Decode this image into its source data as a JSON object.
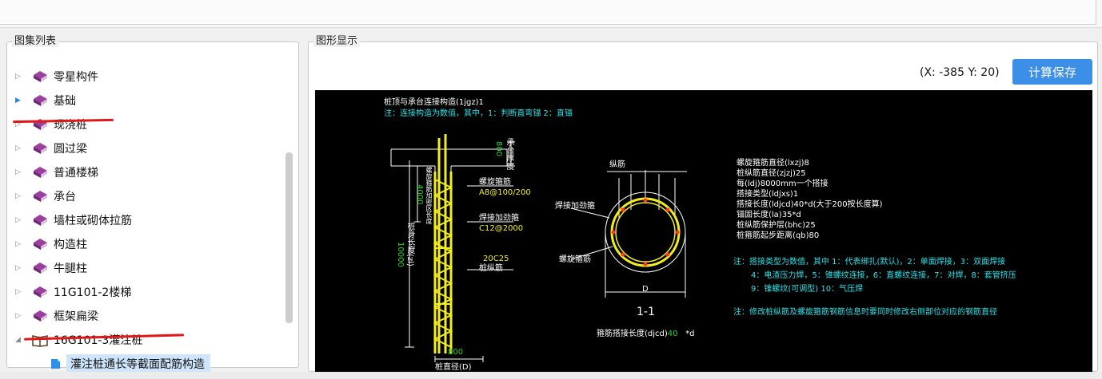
{
  "left_panel": {
    "title": "图集列表",
    "items": [
      {
        "label": "零星构件",
        "arrow": "▷"
      },
      {
        "label": "基础",
        "arrow": "▶"
      },
      {
        "label": "现浇桩",
        "arrow": "▷"
      },
      {
        "label": "圆过梁",
        "arrow": "▷"
      },
      {
        "label": "普通楼梯",
        "arrow": "▷"
      },
      {
        "label": "承台",
        "arrow": "▷"
      },
      {
        "label": "墙柱或砌体拉筋",
        "arrow": "▷"
      },
      {
        "label": "构造柱",
        "arrow": "▷"
      },
      {
        "label": "牛腿柱",
        "arrow": "▷"
      },
      {
        "label": "11G101-2楼梯",
        "arrow": "▷"
      },
      {
        "label": "框架扁梁",
        "arrow": "▷"
      },
      {
        "label": "16G101-3灌注桩",
        "arrow": "◢"
      }
    ],
    "child": {
      "label": "灌注桩通长等截面配筋构造"
    }
  },
  "right_panel": {
    "title": "图形显示",
    "coord": "(X: -385 Y: 20)",
    "calc_button": "计算保存"
  },
  "drawing": {
    "header1": "桩顶与承台连接构造(1jgz)1",
    "header2": "注：连接构造为数值，其中，1：判断直弯锚      2：直锚",
    "d800top": "800",
    "d_embed": "承台厚度",
    "d4000": "4000",
    "d_spiral_len": "螺旋箍筋加密区长度",
    "d10000": "10000",
    "d_pile_len": "桩身长度(zl)",
    "lbl_spiral": "螺旋箍筋",
    "val_spiral": "A8@100/200",
    "lbl_add": "焊接加劲箍",
    "val_add": "C12@2000",
    "val_long": "20C25",
    "lbl_long": "桩纵筋",
    "d800bot": "800",
    "lbl_dia": "桩直径(D)",
    "sec_long": "纵筋",
    "sec_add": "焊接加劲箍",
    "sec_spiral": "螺旋箍筋",
    "sec_D": "D",
    "sec_title": "1-1",
    "sec_lap": "箍筋搭接长度(djcd)",
    "sec_lap_v": "40",
    "sec_lap_u": "*d",
    "p1": "螺旋箍筋直径(lxzj)8",
    "p2": "桩纵筋直径(zjzj)25",
    "p3": "每(ldj)8000mm一个搭接",
    "p4": "搭接类型(ldjxs)1",
    "p5": "搭接长度(ldjcd)40*d(大于200按长度算)",
    "p6": "锚固长度(la)35*d",
    "p7": "桩纵筋保护层(bhc)25",
    "p8": "桩箍筋起步距离(qb)80",
    "n1": "注：搭接类型为数值，其中 1：代表绑扎(默认)，2：单面焊接，3：双面焊接",
    "n2": "4：电渣压力焊，5：锥螺纹连接，6：直螺纹连接，7：对焊，8：套管挤压",
    "n3": "9：锥螺纹(可调型) 10：气压焊",
    "n4": "注：修改桩纵筋及螺旋箍筋钢筋信息时要同时修改右侧部位对应的钢筋直径"
  },
  "colors": {
    "accent": "#3b8fe6",
    "underline": "#e01818",
    "cad_bg": "#000000",
    "cad_yellow": "#f2ee1d",
    "cad_cyan": "#28e3ea",
    "cad_green": "#26d626"
  }
}
